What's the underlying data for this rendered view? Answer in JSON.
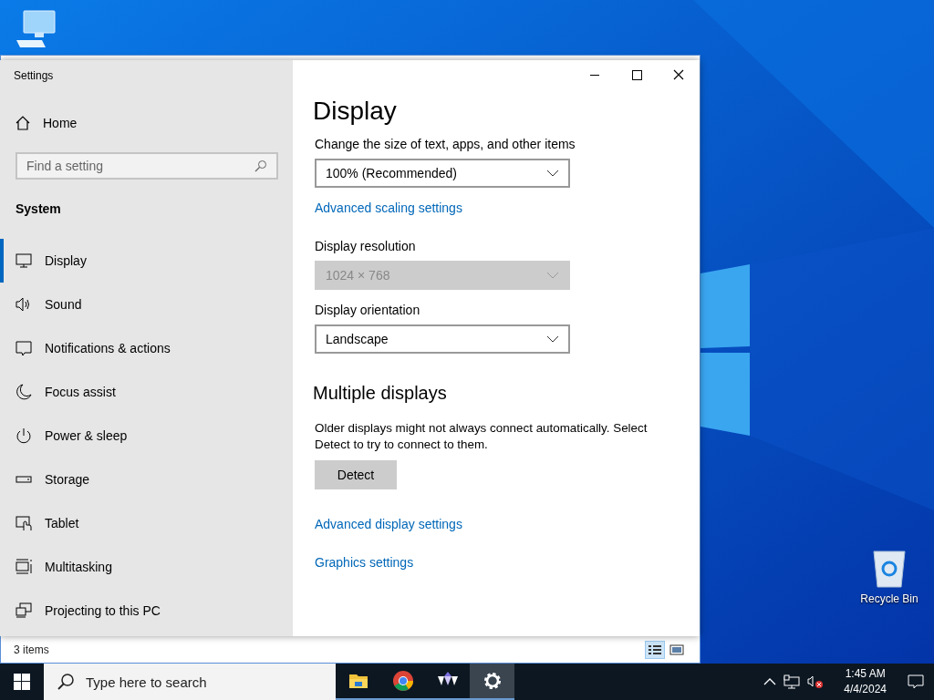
{
  "desktop": {
    "icons": [
      {
        "kind": "computer"
      },
      {
        "kind": "recycle-bin",
        "label": "Recycle Bin"
      }
    ]
  },
  "explorer_window": {
    "status_bar": {
      "text": "3 items",
      "views": [
        {
          "kind": "details",
          "selected": true
        },
        {
          "kind": "tiles",
          "selected": false
        }
      ]
    }
  },
  "settings_window": {
    "title": "Settings",
    "sidebar": {
      "home": "Home",
      "search": {
        "placeholder": "Find a setting"
      },
      "section": "System",
      "items": [
        {
          "label": "Display",
          "kind": "display",
          "selected": true
        },
        {
          "label": "Sound",
          "kind": "sound",
          "selected": false
        },
        {
          "label": "Notifications & actions",
          "kind": "notifications",
          "selected": false
        },
        {
          "label": "Focus assist",
          "kind": "moon",
          "selected": false
        },
        {
          "label": "Power & sleep",
          "kind": "power",
          "selected": false
        },
        {
          "label": "Storage",
          "kind": "storage",
          "selected": false
        },
        {
          "label": "Tablet",
          "kind": "tablet",
          "selected": false
        },
        {
          "label": "Multitasking",
          "kind": "multitasking",
          "selected": false
        },
        {
          "label": "Projecting to this PC",
          "kind": "projecting",
          "selected": false
        }
      ]
    },
    "content": {
      "title": "Display",
      "blocks": [
        {
          "kind": "label",
          "text": "Change the size of text, apps, and other items"
        },
        {
          "kind": "dropdown",
          "value": "100% (Recommended)",
          "disabled": false
        },
        {
          "kind": "link",
          "text": "Advanced scaling settings"
        },
        {
          "kind": "label",
          "text": "Display resolution"
        },
        {
          "kind": "dropdown",
          "value": "1024 × 768",
          "disabled": true
        },
        {
          "kind": "label",
          "text": "Display orientation"
        },
        {
          "kind": "dropdown",
          "value": "Landscape",
          "disabled": false
        },
        {
          "kind": "heading",
          "text": "Multiple displays"
        },
        {
          "kind": "paragraph",
          "text": "Older displays might not always connect automatically. Select Detect to try to connect to them."
        },
        {
          "kind": "button",
          "text": "Detect"
        },
        {
          "kind": "link",
          "text": "Advanced display settings"
        },
        {
          "kind": "link",
          "text": "Graphics settings"
        }
      ]
    }
  },
  "taskbar": {
    "search": {
      "placeholder": "Type here to search"
    },
    "apps": [
      {
        "kind": "folder",
        "active": false
      },
      {
        "kind": "browser",
        "active": false
      },
      {
        "kind": "triangles",
        "active": false
      },
      {
        "kind": "settings",
        "active": true
      }
    ],
    "clock": {
      "time": "1:45 AM",
      "date": "4/4/2024"
    }
  }
}
